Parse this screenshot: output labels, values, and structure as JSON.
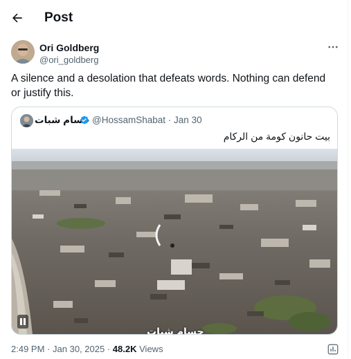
{
  "header": {
    "back_icon": "arrow-left-icon",
    "title": "Post"
  },
  "author": {
    "name": "Ori Goldberg",
    "handle": "@ori_goldberg",
    "more_icon": "more-horizontal-icon"
  },
  "tweet": {
    "text": "A silence and a desolation that defeats words. Nothing can defend or justify this."
  },
  "quoted": {
    "name": "حسام شبات",
    "verified_icon": "verified-badge-icon",
    "handle": "@HossamShabat",
    "separator": "·",
    "date": "Jan 30",
    "text": "بيت حانون كومة من الركام",
    "media_watermark": "حسام شبات",
    "media_icon": "pause-icon"
  },
  "meta": {
    "time": "2:49 PM",
    "date": "Jan 30, 2025",
    "sep": "·",
    "views_count": "48.2K",
    "views_label": "Views",
    "analytics_icon": "analytics-icon"
  },
  "colors": {
    "text": "#0f1419",
    "secondary": "#536471",
    "border": "#cfd9de",
    "verified": "#1d9bf0"
  }
}
